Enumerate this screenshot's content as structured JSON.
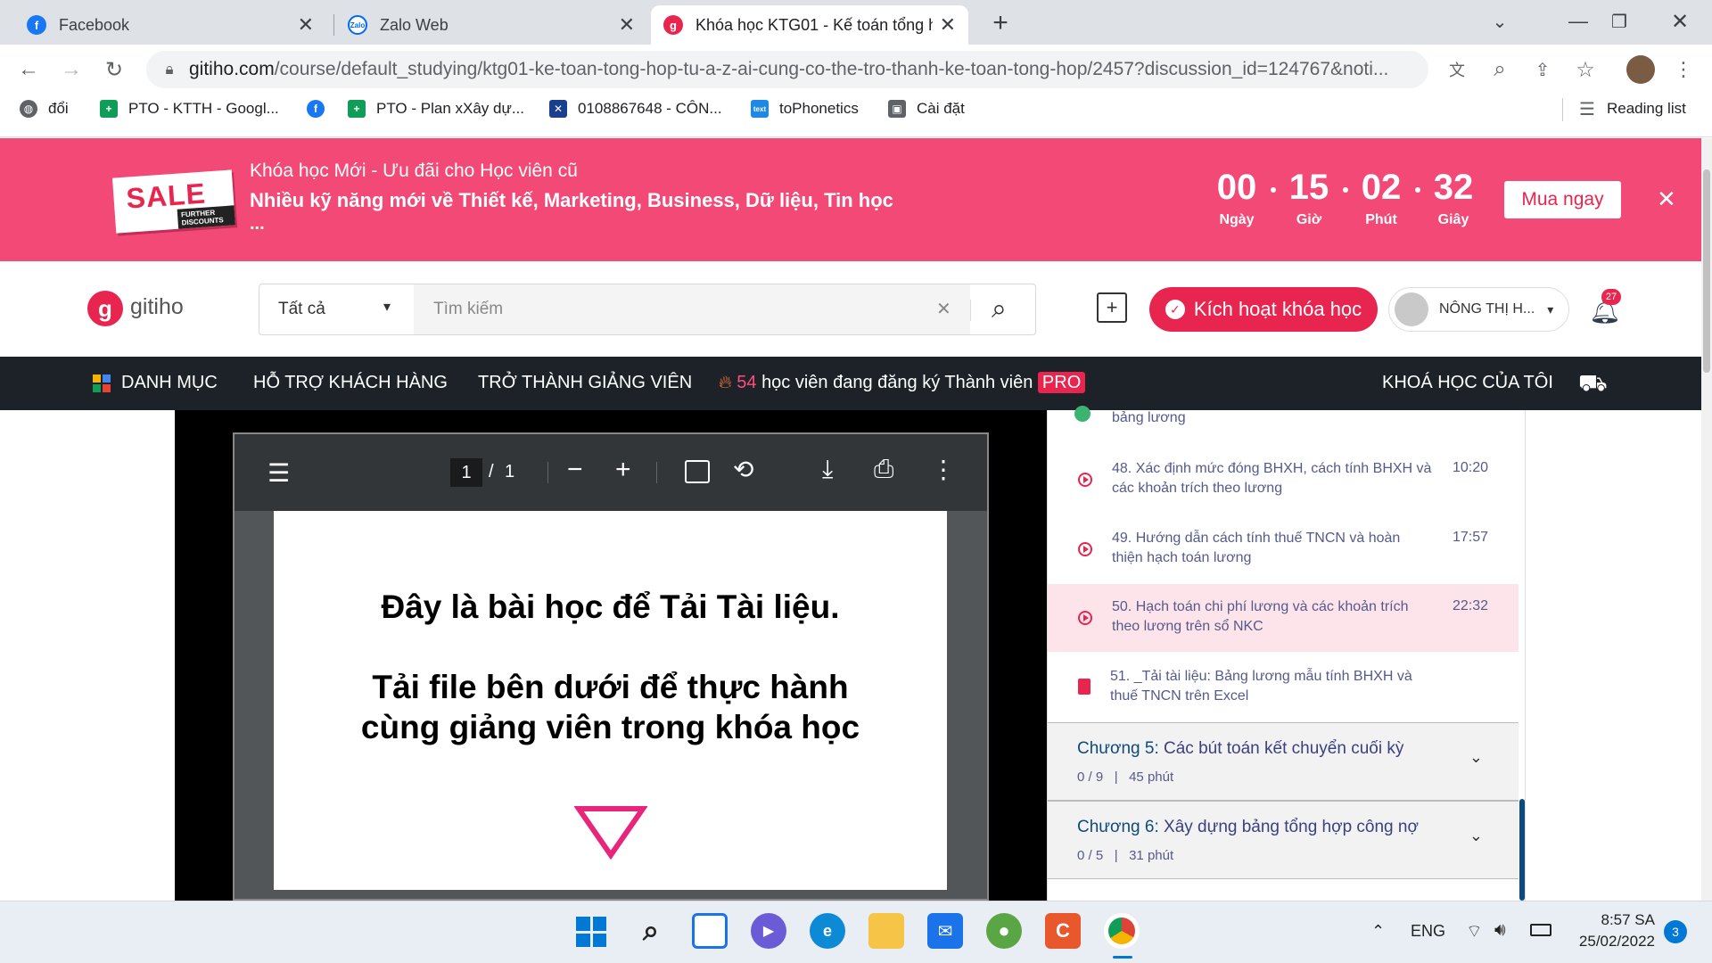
{
  "browser": {
    "tabs": [
      {
        "title": "Facebook",
        "icon": "facebook-icon"
      },
      {
        "title": "Zalo Web",
        "icon": "zalo-icon"
      },
      {
        "title": "Khóa học KTG01 - Kế toán tổng h",
        "icon": "gitiho-icon"
      }
    ],
    "url_host": "gitiho.com",
    "url_path": "/course/default_studying/ktg01-ke-toan-tong-hop-tu-a-z-ai-cung-co-the-tro-thanh-ke-toan-tong-hop/2457?discussion_id=124767&noti...",
    "bookmarks": [
      "đổi",
      "PTO - KTTH - Googl...",
      "PTO - Plan xXây dự...",
      "0108867648 - CÔN...",
      "toPhonetics",
      "Cài đặt"
    ],
    "reading_list": "Reading list"
  },
  "promo": {
    "sale": "SALE",
    "further": "FURTHER DISCOUNTS",
    "line1": "Khóa học Mới - Ưu đãi cho Học viên cũ",
    "line2": "Nhiều kỹ năng mới về Thiết kế, Marketing, Business, Dữ liệu, Tin học",
    "line3": "...",
    "countdown": [
      {
        "value": "00",
        "label": "Ngày"
      },
      {
        "value": "15",
        "label": "Giờ"
      },
      {
        "value": "02",
        "label": "Phút"
      },
      {
        "value": "32",
        "label": "Giây"
      }
    ],
    "buy_label": "Mua ngay"
  },
  "header": {
    "logo_text": "gitiho",
    "category_select": "Tất cả",
    "search_placeholder": "Tìm kiếm",
    "activate_label": "Kích hoạt khóa học",
    "user_name": "NÔNG THỊ H...",
    "notification_count": "27"
  },
  "nav": {
    "catalog": "DANH MỤC",
    "support": "HỖ TRỢ KHÁCH HÀNG",
    "become_teacher": "TRỞ THÀNH GIẢNG VIÊN",
    "live_count": "54",
    "live_text": "học viên đang đăng ký Thành viên",
    "pro_badge": "PRO",
    "my_courses": "KHOÁ HỌC CỦA TÔI"
  },
  "pdf": {
    "page_current": "1",
    "page_total": "1",
    "line1": "Đây là bài học để Tải Tài liệu.",
    "line2": "Tải file bên dưới để thực hành",
    "line3": "cùng giảng viên trong khóa học"
  },
  "lessons": {
    "prev_tail": "bảng lương",
    "items": [
      {
        "title": "48. Xác định mức đóng BHXH, cách tính BHXH và các khoản trích theo lương",
        "duration": "10:20"
      },
      {
        "title": "49. Hướng dẫn cách tính thuế TNCN và hoàn thiện hạch toán lương",
        "duration": "17:57"
      },
      {
        "title": "50. Hạch toán chi phí lương và các khoản trích theo lương trên sổ NKC",
        "duration": "22:32"
      },
      {
        "title": "51. _Tải tài liệu: Bảng lương mẫu tính BHXH và thuế TNCN trên Excel",
        "duration": ""
      }
    ],
    "chapters": [
      {
        "prefix": "Chương 5:",
        "name": "Các bút toán kết chuyển cuối kỳ",
        "progress": "0 / 9",
        "length": "45 phút"
      },
      {
        "prefix": "Chương 6:",
        "name": "Xây dựng bảng tổng hợp công nợ",
        "progress": "0 / 5",
        "length": "31 phút"
      }
    ]
  },
  "taskbar": {
    "lang": "ENG",
    "time": "8:57 SA",
    "date": "25/02/2022",
    "notif": "3"
  },
  "colors": {
    "brand": "#e8254f",
    "promo_bg": "#f24977",
    "nav_bg": "#1c2228",
    "active_lesson_bg": "#fde4ea"
  }
}
